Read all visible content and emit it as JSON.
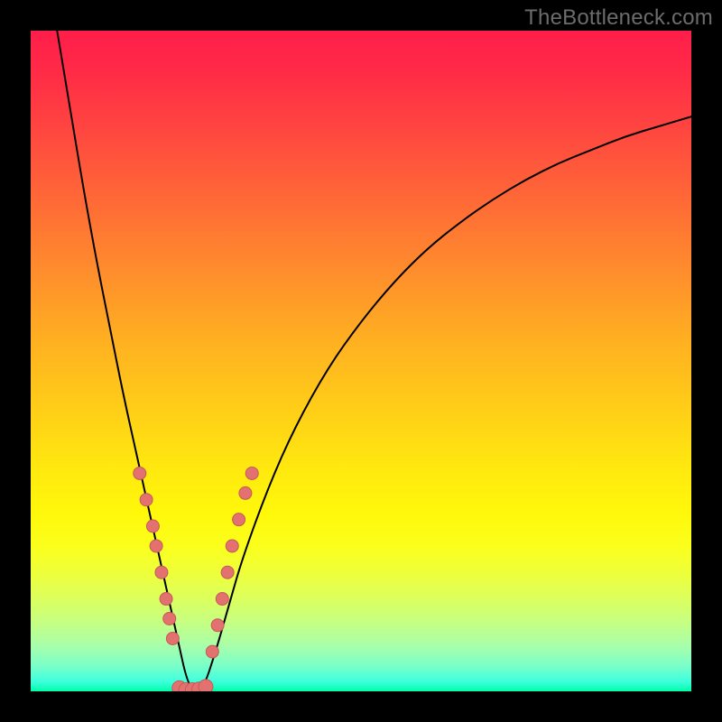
{
  "watermark": "TheBottleneck.com",
  "colors": {
    "frame": "#000000",
    "curve": "#000000",
    "marker_fill": "#e2716f",
    "marker_stroke": "#c55a58"
  },
  "chart_data": {
    "type": "line",
    "title": "",
    "xlabel": "",
    "ylabel": "",
    "xlim": [
      0,
      100
    ],
    "ylim": [
      0,
      100
    ],
    "grid": false,
    "legend": false,
    "curve": {
      "note": "V-shaped bottleneck curve (percent mismatch vs. axis). Minimum (0%) at x≈24. Values read from vertical position on the gradient, 0 bottom / 100 top.",
      "x": [
        4,
        6,
        8,
        10,
        12,
        14,
        16,
        18,
        20,
        22,
        24,
        26,
        28,
        30,
        32,
        36,
        40,
        45,
        50,
        55,
        60,
        65,
        70,
        75,
        80,
        85,
        90,
        95,
        100
      ],
      "values": [
        100,
        88,
        76,
        65,
        55,
        45,
        36,
        27,
        18,
        9,
        0,
        0,
        6,
        13,
        20,
        31,
        40,
        49,
        56,
        62,
        67,
        71,
        74.5,
        77.5,
        80,
        82,
        84,
        85.5,
        87
      ]
    },
    "series": [
      {
        "name": "markers-left",
        "note": "Salmon dots along descending limb (coarse readings)",
        "x": [
          16.5,
          17.5,
          18.5,
          19,
          19.8,
          20.5,
          21,
          21.5
        ],
        "values": [
          33,
          29,
          25,
          22,
          18,
          14,
          11,
          8
        ]
      },
      {
        "name": "markers-bottom",
        "note": "Cluster at trough",
        "x": [
          22.5,
          23.5,
          24.5,
          25.5,
          26.5
        ],
        "values": [
          0.5,
          0.2,
          0.2,
          0.3,
          0.7
        ]
      },
      {
        "name": "markers-right",
        "note": "Salmon dots along ascending limb (coarse readings)",
        "x": [
          27.5,
          28.3,
          29,
          29.8,
          30.5,
          31.5,
          32.5,
          33.5
        ],
        "values": [
          6,
          10,
          14,
          18,
          22,
          26,
          30,
          33
        ]
      }
    ]
  }
}
